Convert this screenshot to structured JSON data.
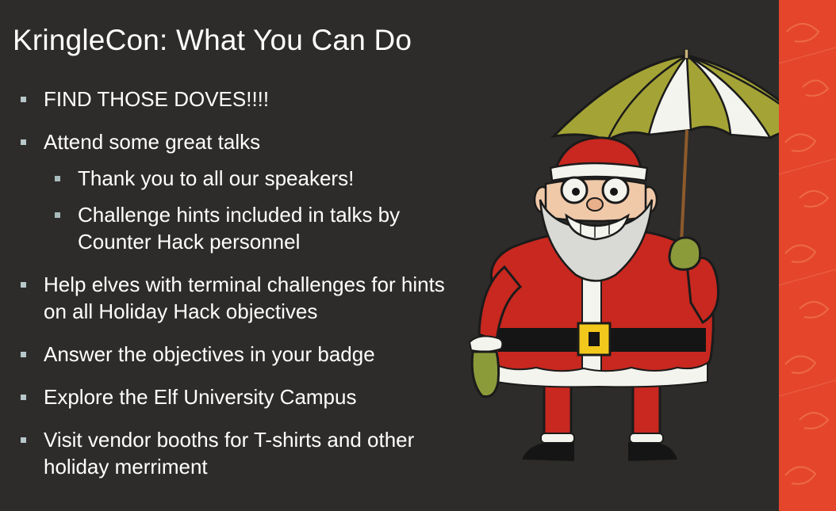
{
  "slide": {
    "title": "KringleCon: What You Can Do",
    "bullets": [
      "FIND THOSE DOVES!!!!",
      "Attend some great talks",
      "Help elves with terminal challenges for hints on all Holiday Hack objectives",
      "Answer the objectives in your badge",
      "Explore the Elf University Campus",
      "Visit vendor booths for T-shirts and other holiday merriment"
    ],
    "sub_bullets": [
      "Thank you to all our speakers!",
      "Challenge hints included in talks by Counter Hack personnel"
    ]
  },
  "colors": {
    "background": "#2d2c2a",
    "text": "#ffffff",
    "bullet": "#b8c7c9",
    "accent_strip": "#e5462b",
    "santa_red": "#c8281f",
    "umbrella_green": "#a4a336",
    "belt_buckle": "#f2c81c"
  },
  "icons": {
    "bullet": "square-bullet-icon",
    "illustration": "santa-umbrella-illustration"
  }
}
